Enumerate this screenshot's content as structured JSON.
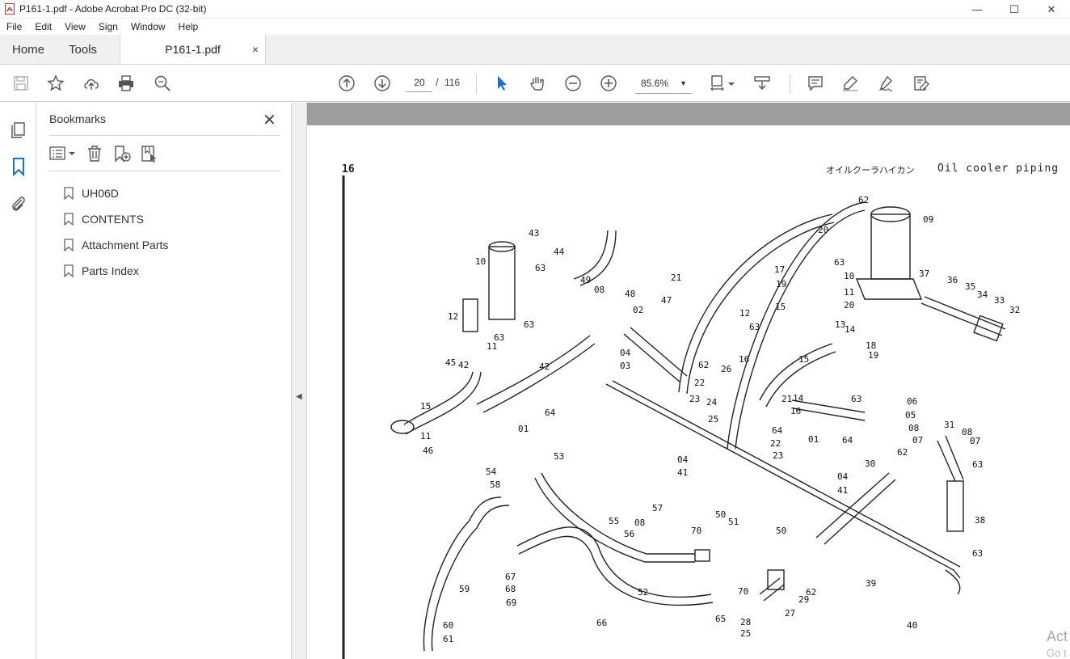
{
  "window": {
    "title": "P161-1.pdf - Adobe Acrobat Pro DC (32-bit)",
    "controls": [
      "—",
      "☐",
      "✕"
    ]
  },
  "menu": [
    "File",
    "Edit",
    "View",
    "Sign",
    "Window",
    "Help"
  ],
  "tabs": {
    "home": "Home",
    "tools": "Tools",
    "document": "P161-1.pdf",
    "close": "×"
  },
  "toolbar": {
    "page_current": "20",
    "page_separator": "/",
    "page_total": "116",
    "zoom": "85.6%"
  },
  "bookmarks": {
    "title": "Bookmarks",
    "close": "✕",
    "items": [
      {
        "label": "UH06D"
      },
      {
        "label": "CONTENTS"
      },
      {
        "label": "Attachment Parts"
      },
      {
        "label": "Parts Index"
      }
    ]
  },
  "document": {
    "page_number": "16",
    "header_jp": "オイルクーラハイカン",
    "header_en": "Oil cooler piping",
    "watermark_line1": "Act",
    "watermark_line2": "Go t",
    "part_labels": [
      "62",
      "09",
      "20",
      "43",
      "44",
      "63",
      "10",
      "21",
      "17",
      "37",
      "36",
      "35",
      "34",
      "33",
      "32",
      "49",
      "08",
      "48",
      "47",
      "02",
      "63",
      "19",
      "10",
      "11",
      "12",
      "42",
      "63",
      "15",
      "13",
      "20",
      "63",
      "11",
      "12",
      "63",
      "14",
      "18",
      "19",
      "16",
      "26",
      "15",
      "45",
      "42",
      "04",
      "03",
      "62",
      "15",
      "64",
      "01",
      "22",
      "23",
      "24",
      "14",
      "21",
      "06",
      "05",
      "08",
      "25",
      "16",
      "63",
      "07",
      "31",
      "08",
      "07",
      "22",
      "23",
      "64",
      "01",
      "64",
      "62",
      "63",
      "30",
      "11",
      "46",
      "53",
      "54",
      "04",
      "41",
      "04",
      "41",
      "58",
      "57",
      "55",
      "08",
      "56",
      "51",
      "50",
      "70",
      "50",
      "38",
      "63",
      "67",
      "68",
      "69",
      "52",
      "70",
      "29",
      "62",
      "39",
      "59",
      "60",
      "61",
      "66",
      "65",
      "28",
      "25",
      "27",
      "40"
    ]
  }
}
